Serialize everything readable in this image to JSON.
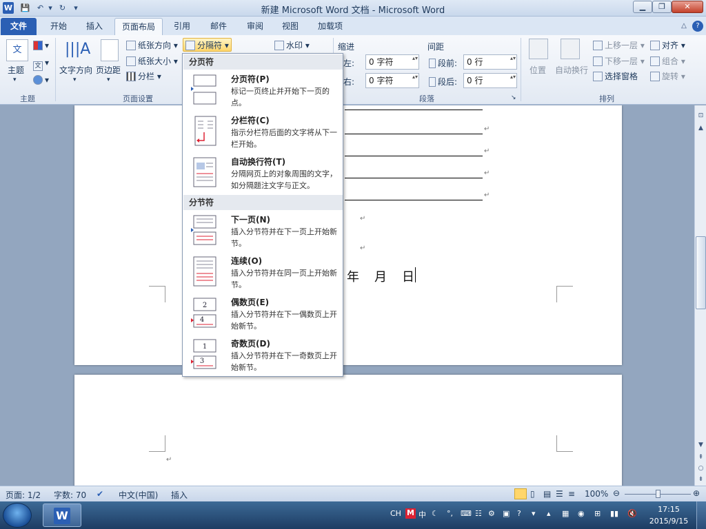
{
  "window": {
    "title": "新建 Microsoft Word 文档 - Microsoft Word"
  },
  "qat": {
    "logo": "W",
    "save": "💾",
    "undo": "↶",
    "redo": "↻",
    "customize": "▾"
  },
  "tabs": [
    {
      "label": "文件"
    },
    {
      "label": "开始"
    },
    {
      "label": "插入"
    },
    {
      "label": "页面布局"
    },
    {
      "label": "引用"
    },
    {
      "label": "邮件"
    },
    {
      "label": "审阅"
    },
    {
      "label": "视图"
    },
    {
      "label": "加载项"
    }
  ],
  "ribbon": {
    "themes": {
      "label": "主题",
      "group": "主题"
    },
    "page_setup": {
      "text_direction": "文字方向",
      "margins": "页边距",
      "orientation": "纸张方向",
      "size": "纸张大小",
      "columns": "分栏",
      "breaks": "分隔符",
      "group": "页面设置"
    },
    "page_bg": {
      "watermark": "水印"
    },
    "paragraph": {
      "indent_title": "缩进",
      "spacing_title": "间距",
      "left": "左:",
      "right": "右:",
      "before": "段前:",
      "after": "段后:",
      "left_val": "0 字符",
      "right_val": "0 字符",
      "before_val": "0 行",
      "after_val": "0 行",
      "group": "段落"
    },
    "arrange": {
      "position": "位置",
      "wrap": "自动换行",
      "bring_forward": "上移一层",
      "send_backward": "下移一层",
      "selection_pane": "选择窗格",
      "align": "对齐",
      "group_btn": "组合",
      "rotate": "旋转",
      "group": "排列"
    }
  },
  "dropdown": {
    "section_page": "分页符",
    "section_section": "分节符",
    "items": [
      {
        "name": "分页符(P)",
        "desc": "标记一页终止并开始下一页的点。"
      },
      {
        "name": "分栏符(C)",
        "desc": "指示分栏符后面的文字将从下一栏开始。"
      },
      {
        "name": "自动换行符(T)",
        "desc": "分隔网页上的对象周围的文字，如分隔题注文字与正文。"
      },
      {
        "name": "下一页(N)",
        "desc": "插入分节符并在下一页上开始新节。"
      },
      {
        "name": "连续(O)",
        "desc": "插入分节符并在同一页上开始新节。"
      },
      {
        "name": "偶数页(E)",
        "desc": "插入分节符并在下一偶数页上开始新节。"
      },
      {
        "name": "奇数页(D)",
        "desc": "插入分节符并在下一奇数页上开始新节。"
      }
    ]
  },
  "document": {
    "date_line": "年　月　日",
    "para_mark": "↵"
  },
  "status": {
    "page": "页面: 1/2",
    "words": "字数: 70",
    "lang": "中文(中国)",
    "mode": "插入",
    "zoom": "100%"
  },
  "taskbar": {
    "ime": "CH",
    "ime_zh": "中",
    "time": "17:15",
    "date": "2015/9/15"
  },
  "colors": {
    "accent": "#2b5fb4",
    "highlight": "#ffd66b"
  }
}
